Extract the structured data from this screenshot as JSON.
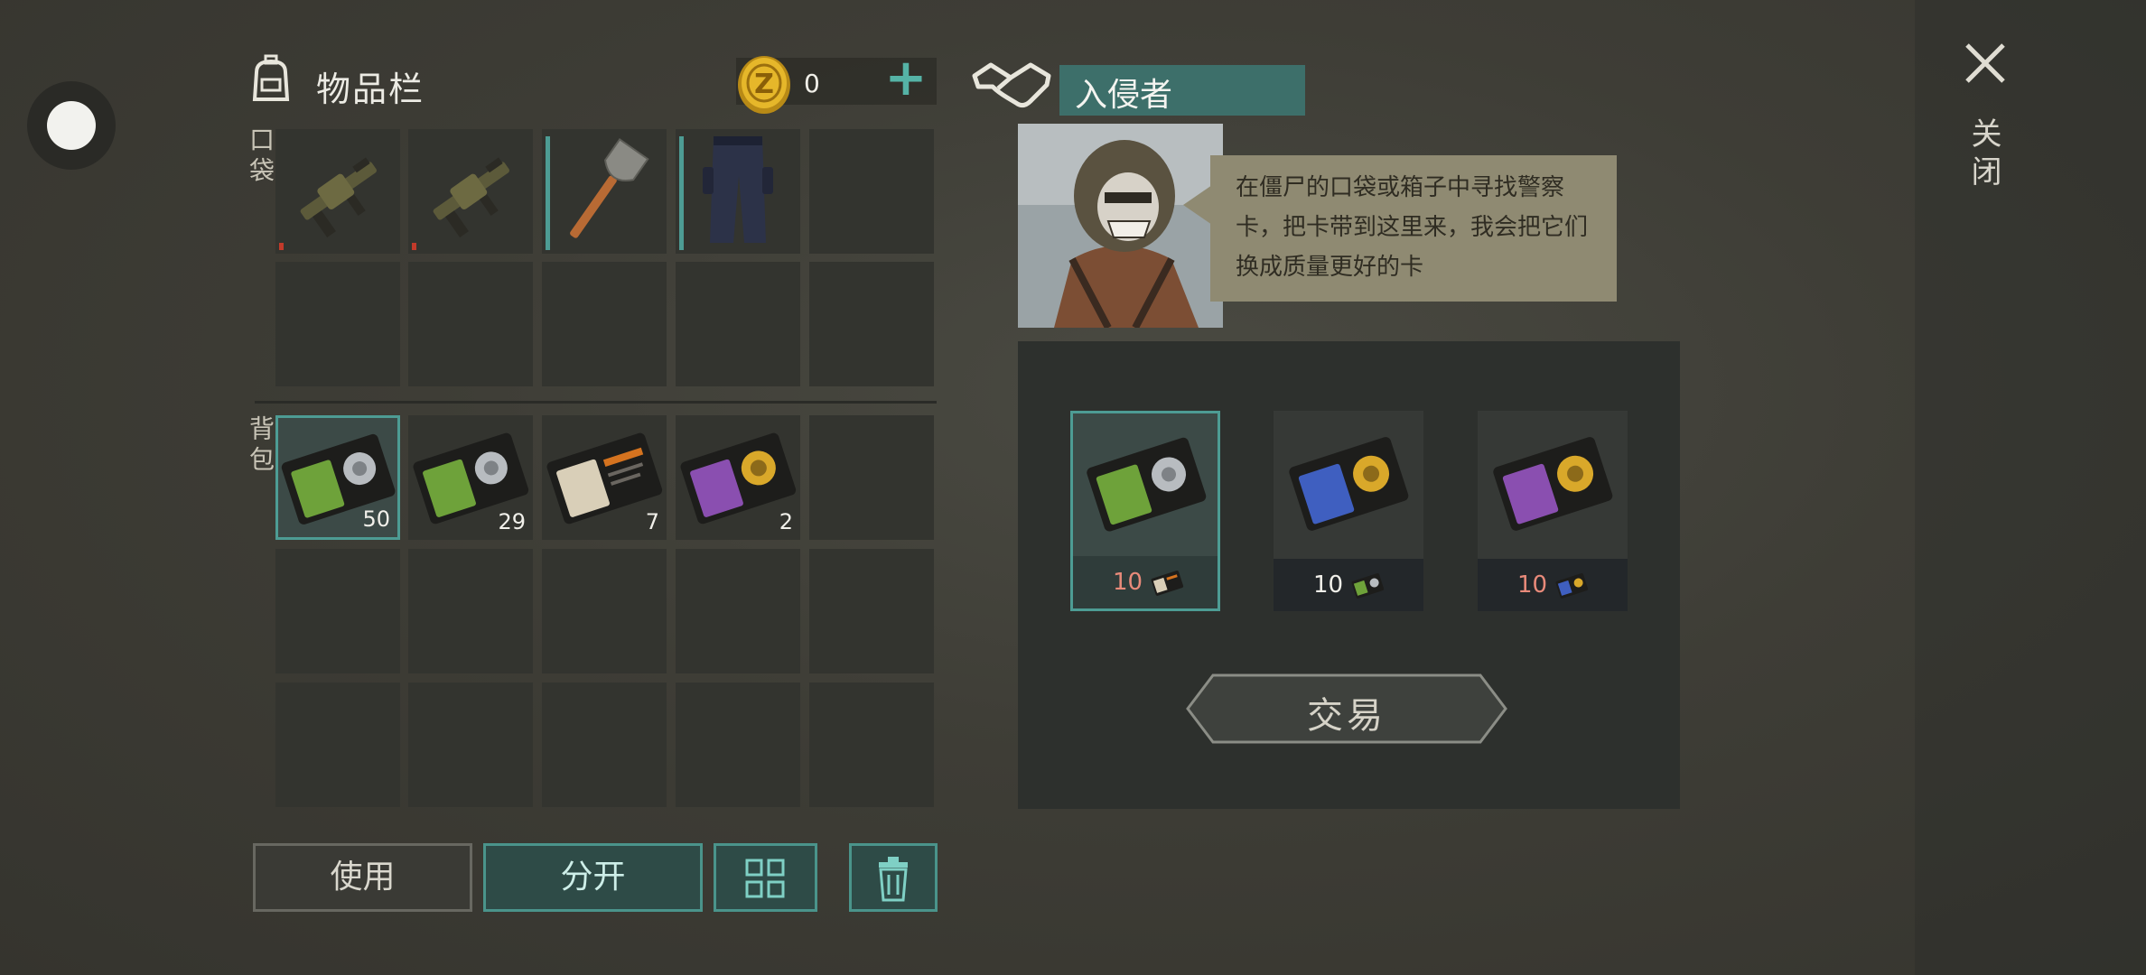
{
  "inventory": {
    "title": "物品栏",
    "coins": "0",
    "plus_label": "+",
    "pocket_label": "口袋",
    "backpack_label": "背包",
    "pocket_items": [
      {
        "name": "grenade-launcher",
        "icon": "grenade-launcher-icon"
      },
      {
        "name": "grenade-launcher",
        "icon": "grenade-launcher-icon"
      },
      {
        "name": "shovel",
        "icon": "shovel-icon"
      },
      {
        "name": "pants",
        "icon": "pants-icon"
      }
    ],
    "backpack_items": [
      {
        "icon": "green-police-card-icon",
        "count": "50"
      },
      {
        "icon": "green-police-card-icon",
        "count": "29"
      },
      {
        "icon": "tan-card-icon",
        "count": "7"
      },
      {
        "icon": "purple-police-card-icon",
        "count": "2"
      }
    ]
  },
  "actions": {
    "use_label": "使用",
    "split_label": "分开"
  },
  "trader": {
    "name": "入侵者",
    "speech": "在僵尸的口袋或箱子中寻找警察卡，把卡带到这里来，我会把它们换成质量更好的卡",
    "offers": [
      {
        "icon": "green-police-card-icon",
        "cost": "10",
        "cost_icon": "tan-card-icon",
        "cost_color": "#e88a7a"
      },
      {
        "icon": "blue-police-card-icon",
        "cost": "10",
        "cost_icon": "green-police-card-icon",
        "cost_color": "#f1f0ea"
      },
      {
        "icon": "purple-police-card-icon",
        "cost": "10",
        "cost_icon": "blue-police-card-icon",
        "cost_color": "#e88a7a"
      }
    ],
    "trade_label": "交易"
  },
  "close_label": "关闭",
  "colors": {
    "accent": "#4d9c94",
    "panel": "#2d302d",
    "speech_bg": "#8f8a72"
  }
}
